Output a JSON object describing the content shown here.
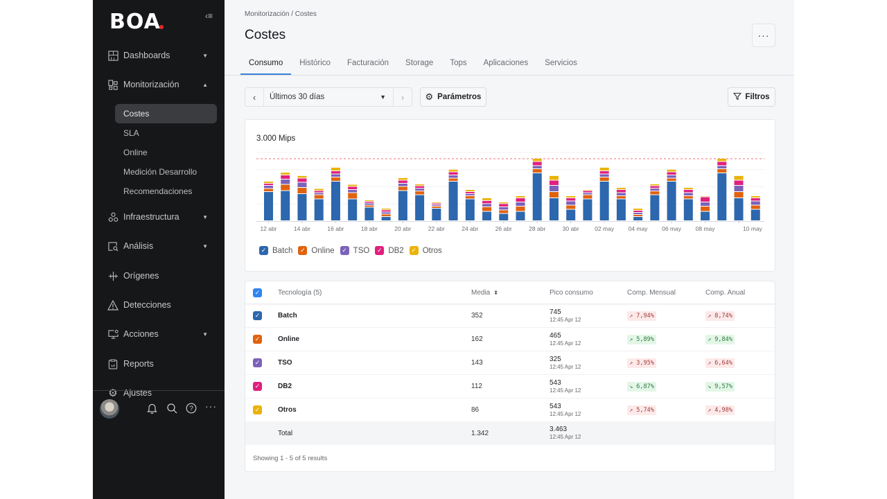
{
  "app": {
    "logo": "BOA",
    "collapse_icon": "collapse-sidebar-icon"
  },
  "sidebar": {
    "items": [
      {
        "label": "Dashboards",
        "icon": "dashboard-icon",
        "expandable": true,
        "expanded": false
      },
      {
        "label": "Monitorización",
        "icon": "monitoring-icon",
        "expandable": true,
        "expanded": true,
        "children": [
          {
            "label": "Costes",
            "active": true
          },
          {
            "label": "SLA"
          },
          {
            "label": "Online"
          },
          {
            "label": "Medición Desarrollo"
          },
          {
            "label": "Recomendaciones"
          }
        ]
      },
      {
        "label": "Infraestructura",
        "icon": "infrastructure-icon",
        "expandable": true,
        "expanded": false
      },
      {
        "label": "Análisis",
        "icon": "analysis-icon",
        "expandable": true,
        "expanded": false
      },
      {
        "label": "Orígenes",
        "icon": "origins-icon",
        "expandable": false
      },
      {
        "label": "Detecciones",
        "icon": "warning-icon",
        "expandable": false
      },
      {
        "label": "Acciones",
        "icon": "actions-icon",
        "expandable": true,
        "expanded": false
      },
      {
        "label": "Reports",
        "icon": "reports-icon",
        "expandable": false
      },
      {
        "label": "Ajustes",
        "icon": "gear-icon",
        "expandable": false
      }
    ],
    "bottom_icons": [
      "bell-icon",
      "search-icon",
      "help-icon",
      "more-icon"
    ]
  },
  "header": {
    "breadcrumb": "Monitorización / Costes",
    "title": "Costes",
    "more_label": "···"
  },
  "tabs": [
    {
      "label": "Consumo",
      "active": true
    },
    {
      "label": "Histórico"
    },
    {
      "label": "Facturación"
    },
    {
      "label": "Storage"
    },
    {
      "label": "Tops"
    },
    {
      "label": "Aplicaciones"
    },
    {
      "label": "Servicios"
    }
  ],
  "toolbar": {
    "prev": "‹",
    "next": "›",
    "period": "Últimos 30 días",
    "params_label": "Parámetros",
    "filters_label": "Filtros"
  },
  "colors": {
    "Batch": "#2d67ad",
    "Online": "#e0620f",
    "TSO": "#7b62b8",
    "DB2": "#e0207e",
    "Otros": "#eab308",
    "threshold": "#f26d6d",
    "accent": "#3b82d6"
  },
  "chart_data": {
    "type": "bar",
    "stacked": true,
    "title": "3.000 Mips",
    "threshold": 3000,
    "ylim": [
      0,
      3300
    ],
    "x_tick_labels": [
      "12 abr",
      "14 abr",
      "16 abr",
      "18 abr",
      "20 abr",
      "22 abr",
      "24 abr",
      "26 abr",
      "28 abr",
      "30 abr",
      "02 may",
      "04 may",
      "06 may",
      "08 may",
      "10 may"
    ],
    "categories": [
      "12 abr",
      "13 abr",
      "14 abr",
      "15 abr",
      "16 abr",
      "17 abr",
      "18 abr",
      "19 abr",
      "20 abr",
      "21 abr",
      "22 abr",
      "23 abr",
      "24 abr",
      "25 abr",
      "26 abr",
      "27 abr",
      "28 abr",
      "29 abr",
      "30 abr",
      "01 may",
      "02 may",
      "03 may",
      "04 may",
      "05 may",
      "06 may",
      "07 may",
      "08 may",
      "09 may",
      "10 may",
      "11 may"
    ],
    "series": [
      {
        "name": "Batch",
        "values": [
          1400,
          1450,
          1300,
          1050,
          1900,
          1050,
          650,
          200,
          1450,
          1250,
          600,
          1900,
          1050,
          450,
          350,
          450,
          2300,
          1100,
          550,
          1050,
          1900,
          1050,
          200,
          1250,
          1900,
          1050,
          450,
          2300,
          1100,
          550
        ]
      },
      {
        "name": "Online",
        "values": [
          150,
          300,
          300,
          200,
          200,
          300,
          100,
          120,
          200,
          180,
          100,
          150,
          150,
          220,
          170,
          250,
          200,
          300,
          200,
          200,
          200,
          150,
          100,
          180,
          150,
          150,
          250,
          200,
          300,
          200
        ]
      },
      {
        "name": "TSO",
        "values": [
          150,
          250,
          250,
          100,
          150,
          150,
          100,
          100,
          150,
          130,
          70,
          150,
          100,
          150,
          150,
          200,
          150,
          300,
          200,
          100,
          150,
          150,
          100,
          130,
          150,
          150,
          200,
          150,
          300,
          200
        ]
      },
      {
        "name": "DB2",
        "values": [
          100,
          200,
          200,
          100,
          150,
          150,
          80,
          100,
          150,
          120,
          70,
          150,
          100,
          150,
          150,
          200,
          200,
          250,
          150,
          100,
          150,
          150,
          100,
          120,
          150,
          150,
          250,
          200,
          250,
          150
        ]
      },
      {
        "name": "Otros",
        "values": [
          100,
          130,
          120,
          100,
          170,
          100,
          70,
          80,
          120,
          90,
          60,
          120,
          100,
          130,
          80,
          100,
          150,
          220,
          100,
          50,
          170,
          100,
          100,
          90,
          120,
          100,
          50,
          150,
          220,
          100
        ]
      }
    ],
    "legend": [
      "Batch",
      "Online",
      "TSO",
      "DB2",
      "Otros"
    ],
    "legend_position": "bottom-left",
    "grid": true
  },
  "table": {
    "headers": {
      "tech": "Tecnología (5)",
      "media": "Media",
      "pico": "Pico consumo",
      "mensual": "Comp. Mensual",
      "anual": "Comp. Anual"
    },
    "rows": [
      {
        "name": "Batch",
        "color_key": "Batch",
        "media": "352",
        "pico": "745",
        "pico_time": "12:45 Apr 12",
        "mensual": "7,94%",
        "mensual_dir": "up",
        "mensual_status": "bad",
        "anual": "8,74%",
        "anual_dir": "up",
        "anual_status": "bad"
      },
      {
        "name": "Online",
        "color_key": "Online",
        "media": "162",
        "pico": "465",
        "pico_time": "12:45 Apr 12",
        "mensual": "5,89%",
        "mensual_dir": "up",
        "mensual_status": "good",
        "anual": "9,84%",
        "anual_dir": "up",
        "anual_status": "good"
      },
      {
        "name": "TSO",
        "color_key": "TSO",
        "media": "143",
        "pico": "325",
        "pico_time": "12:45 Apr 12",
        "mensual": "3,95%",
        "mensual_dir": "up",
        "mensual_status": "bad",
        "anual": "6,64%",
        "anual_dir": "up",
        "anual_status": "bad"
      },
      {
        "name": "DB2",
        "color_key": "DB2",
        "media": "112",
        "pico": "543",
        "pico_time": "12:45 Apr 12",
        "mensual": "6,87%",
        "mensual_dir": "down",
        "mensual_status": "good",
        "anual": "9,57%",
        "anual_dir": "down",
        "anual_status": "good"
      },
      {
        "name": "Otros",
        "color_key": "Otros",
        "media": "86",
        "pico": "543",
        "pico_time": "12:45 Apr 12",
        "mensual": "5,74%",
        "mensual_dir": "up",
        "mensual_status": "bad",
        "anual": "4,98%",
        "anual_dir": "up",
        "anual_status": "bad"
      }
    ],
    "total": {
      "label": "Total",
      "media": "1.342",
      "pico": "3.463",
      "pico_time": "12:45 Apr 12"
    },
    "footer": "Showing 1 - 5 of 5 results"
  }
}
